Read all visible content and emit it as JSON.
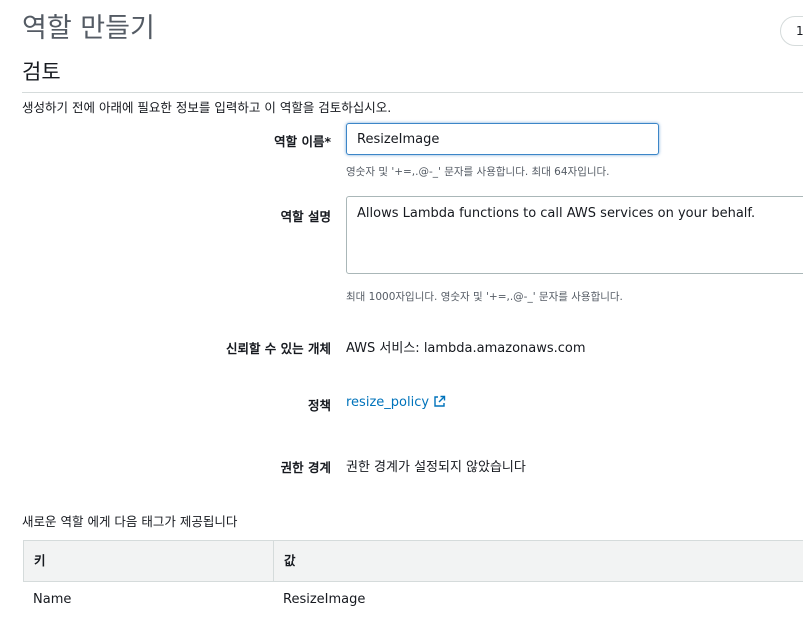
{
  "header": {
    "title": "역할 만들기",
    "step": "1"
  },
  "review": {
    "title": "검토",
    "intro": "생성하기 전에 아래에 필요한 정보를 입력하고 이 역할을 검토하십시오."
  },
  "form": {
    "role_name_label": "역할 이름*",
    "role_name_value": "ResizeImage",
    "role_name_hint": "영숫자 및 '+=,.@-_' 문자를 사용합니다. 최대 64자입니다.",
    "description_label": "역할 설명",
    "description_value": "Allows Lambda functions to call AWS services on your behalf.",
    "description_hint": "최대 1000자입니다. 영숫자 및 '+=,.@-_' 문자를 사용합니다.",
    "trusted_entity_label": "신뢰할 수 있는 개체",
    "trusted_entity_value": "AWS 서비스: lambda.amazonaws.com",
    "policy_label": "정책",
    "policy_link": "resize_policy",
    "boundary_label": "권한 경계",
    "boundary_value": "권한 경계가 설정되지 않았습니다"
  },
  "tags": {
    "heading": "새로운 역할 에게 다음 태그가 제공됩니다",
    "columns": {
      "key": "키",
      "value": "값"
    },
    "rows": [
      {
        "key": "Name",
        "value": "ResizeImage"
      }
    ]
  },
  "colors": {
    "link": "#0073bb",
    "focus_border": "#3c86c8",
    "table_header_bg": "#f2f3f3",
    "muted_text": "#545b64"
  },
  "icons": {
    "policy_link_icon": "external-link-icon"
  }
}
